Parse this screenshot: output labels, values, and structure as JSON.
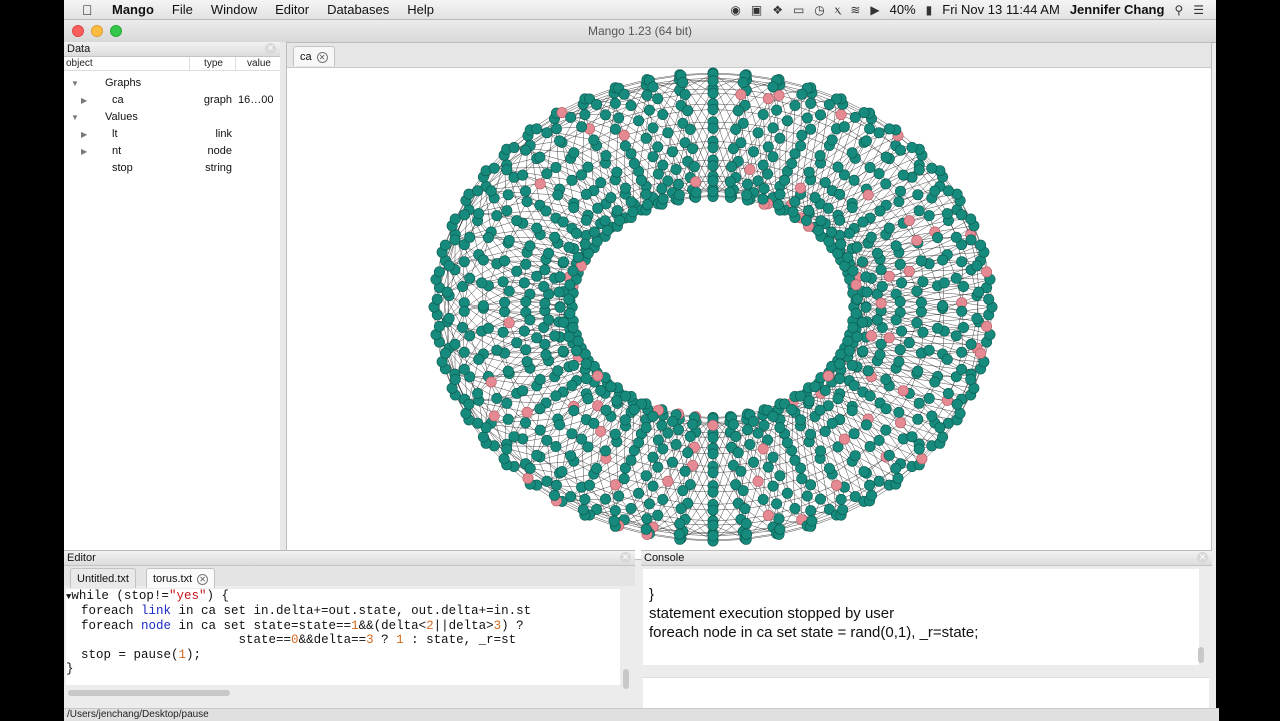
{
  "menubar": {
    "app_name": "Mango",
    "items": [
      "File",
      "Window",
      "Editor",
      "Databases",
      "Help"
    ],
    "battery": "40%",
    "datetime": "Fri Nov 13  11:44 AM",
    "user": "Jennifer Chang"
  },
  "window": {
    "title": "Mango 1.23 (64 bit)"
  },
  "data_panel": {
    "title": "Data",
    "columns": [
      "object",
      "type",
      "value"
    ],
    "groups": {
      "graphs": {
        "label": "Graphs",
        "items": [
          {
            "name": "ca",
            "type": "graph",
            "value": "16…00"
          }
        ]
      },
      "values": {
        "label": "Values",
        "items": [
          {
            "name": "lt",
            "type": "link",
            "value": ""
          },
          {
            "name": "nt",
            "type": "node",
            "value": ""
          },
          {
            "name": "stop",
            "type": "string",
            "value": ""
          }
        ]
      }
    }
  },
  "canvas": {
    "tab": "ca",
    "colors": {
      "node": "#168a7c",
      "node_active": "#e58a93",
      "mesh": "#111111",
      "background": "#ffffff"
    }
  },
  "editor": {
    "title": "Editor",
    "tabs": [
      "Untitled.txt",
      "torus.txt"
    ],
    "active_tab": "torus.txt",
    "code": {
      "l1a": "while (stop!=",
      "l1s": "\"yes\"",
      "l1b": ") {",
      "l2a": "  foreach ",
      "l2k": "link",
      "l2b": " in ca set in.delta+=out.state, out.delta+=in.st",
      "l3a": "  foreach ",
      "l3k": "node",
      "l3b": " in ca set state=state==",
      "l3n1": "1",
      "l3c": "&&(delta<",
      "l3n2": "2",
      "l3d": "||delta>",
      "l3n3": "3",
      "l3e": ") ?",
      "l4a": "                       state==",
      "l4n1": "0",
      "l4b": "&&delta==",
      "l4n2": "3",
      "l4c": " ? ",
      "l4n3": "1",
      "l4d": " : state, _r=st",
      "l5a": "",
      "l6a": "  stop = pause(",
      "l6n": "1",
      "l6b": ");",
      "l7a": "}"
    }
  },
  "console": {
    "title": "Console",
    "lines": [
      "}",
      "statement execution stopped by user",
      "foreach node in ca set state = rand(0,1), _r=state;"
    ]
  },
  "status": {
    "path": "/Users/jenchang/Desktop/pause"
  }
}
